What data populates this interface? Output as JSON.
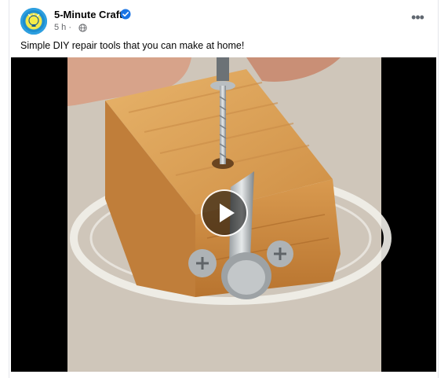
{
  "post": {
    "page_name": "5-Minute Crafts",
    "verified_icon": "verified-badge-icon",
    "time": "5 h",
    "separator": "·",
    "audience_icon": "globe-icon",
    "more_icon": "more-options-icon",
    "more_label": "•••",
    "caption": "Simple DIY repair tools that you can make at home!"
  },
  "video": {
    "play_icon": "play-icon",
    "accent": "#1b74e4"
  }
}
